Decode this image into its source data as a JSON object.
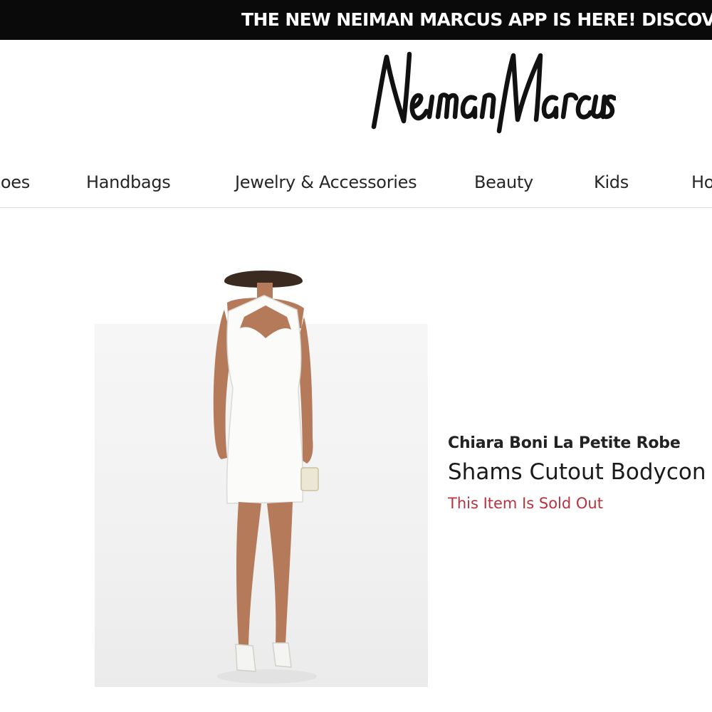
{
  "promo_banner": {
    "text": "THE NEW NEIMAN MARCUS APP IS HERE! DISCOVER NOW"
  },
  "logo": {
    "text": "Neiman Marcus"
  },
  "nav": {
    "items": [
      {
        "label": "Shoes"
      },
      {
        "label": "Handbags"
      },
      {
        "label": "Jewelry & Accessories"
      },
      {
        "label": "Beauty"
      },
      {
        "label": "Kids"
      },
      {
        "label": "Home"
      }
    ]
  },
  "product": {
    "brand": "Chiara Boni La Petite Robe",
    "name": "Shams Cutout Bodycon Dress",
    "stock_status": "This Item Is Sold Out",
    "stock_status_color": "#b5343f",
    "dress_color": "white"
  }
}
